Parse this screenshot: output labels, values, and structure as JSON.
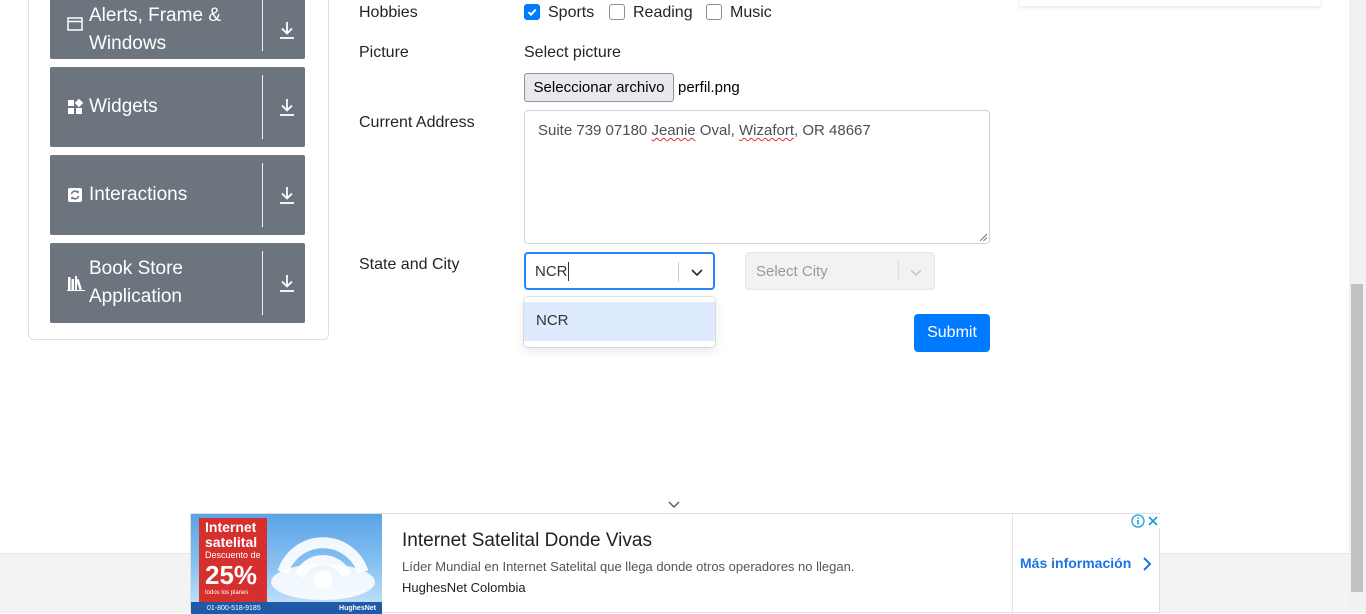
{
  "sidebar": {
    "items": [
      {
        "label": "Alerts, Frame & Windows",
        "icon": "window-icon"
      },
      {
        "label": "Widgets",
        "icon": "widgets-icon"
      },
      {
        "label": "Interactions",
        "icon": "interactions-icon"
      },
      {
        "label": "Book Store Application",
        "icon": "books-icon"
      }
    ]
  },
  "form": {
    "hobbies": {
      "label": "Hobbies",
      "options": [
        {
          "label": "Sports",
          "checked": true
        },
        {
          "label": "Reading",
          "checked": false
        },
        {
          "label": "Music",
          "checked": false
        }
      ]
    },
    "picture": {
      "label": "Picture",
      "hint": "Select picture",
      "button": "Seleccionar archivo",
      "file_name": "perfil.png"
    },
    "address": {
      "label": "Current Address",
      "value_parts": [
        "Suite 739 07180 ",
        "Jeanie",
        " Oval, ",
        "Wizafort",
        ", OR 48667"
      ]
    },
    "state_city": {
      "label": "State and City",
      "state_value": "NCR",
      "state_options": [
        "NCR"
      ],
      "city_placeholder": "Select City"
    },
    "submit_label": "Submit"
  },
  "ad": {
    "image_text": {
      "line1": "Internet",
      "line2": "satelital",
      "line3": "Descuento de",
      "line4": "25%",
      "line5": "todos los planes",
      "phone": "01-800-518-9185",
      "brand": "HughesNet"
    },
    "title": "Internet Satelital Donde Vivas",
    "description": "Líder Mundial en Internet Satelital que llega donde otros operadores no llegan.",
    "company": "HughesNet Colombia",
    "cta": "Más información"
  },
  "colors": {
    "sidebar_card": "#6c757d",
    "primary": "#007bff",
    "focus_border": "#2684ff",
    "option_highlight": "#deebff"
  }
}
